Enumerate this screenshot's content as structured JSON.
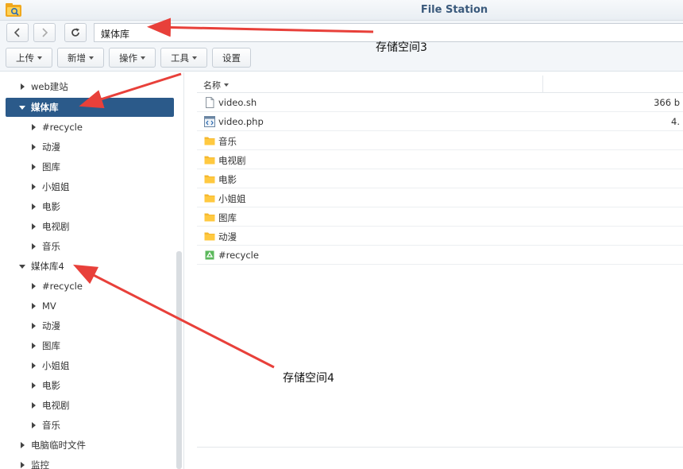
{
  "app": {
    "title": "File Station",
    "icon": "file-station-icon"
  },
  "nav": {
    "back_icon": "chevron-left-icon",
    "forward_icon": "chevron-right-icon",
    "refresh_icon": "refresh-icon",
    "path": "媒体库"
  },
  "toolbar": {
    "upload": "上传",
    "create": "新增",
    "action": "操作",
    "tools": "工具",
    "settings": "设置"
  },
  "tree": {
    "items": [
      {
        "label": "web建站"
      },
      {
        "label": "媒体库"
      },
      {
        "label": "#recycle"
      },
      {
        "label": "动漫"
      },
      {
        "label": "图库"
      },
      {
        "label": "小姐姐"
      },
      {
        "label": "电影"
      },
      {
        "label": "电视剧"
      },
      {
        "label": "音乐"
      },
      {
        "label": "媒体库4"
      },
      {
        "label": "#recycle"
      },
      {
        "label": "MV"
      },
      {
        "label": "动漫"
      },
      {
        "label": "图库"
      },
      {
        "label": "小姐姐"
      },
      {
        "label": "电影"
      },
      {
        "label": "电视剧"
      },
      {
        "label": "音乐"
      },
      {
        "label": "电脑临时文件"
      },
      {
        "label": "监控"
      }
    ]
  },
  "filelist": {
    "column_name": "名称",
    "rows": [
      {
        "name": "video.sh",
        "size": "366 b",
        "icon": "file-icon"
      },
      {
        "name": "video.php",
        "size": "4.",
        "icon": "code-file-icon"
      },
      {
        "name": "音乐",
        "size": "",
        "icon": "folder-icon"
      },
      {
        "name": "电视剧",
        "size": "",
        "icon": "folder-icon"
      },
      {
        "name": "电影",
        "size": "",
        "icon": "folder-icon"
      },
      {
        "name": "小姐姐",
        "size": "",
        "icon": "folder-icon"
      },
      {
        "name": "图库",
        "size": "",
        "icon": "folder-icon"
      },
      {
        "name": "动漫",
        "size": "",
        "icon": "folder-icon"
      },
      {
        "name": "#recycle",
        "size": "",
        "icon": "recycle-folder-icon"
      }
    ]
  },
  "annotations": {
    "label_3": "存储空间3",
    "label_4": "存储空间4",
    "arrow_color": "#e8403a"
  },
  "colors": {
    "selected_bg": "#2b5a8a",
    "folder": "#f5b82e",
    "recycle": "#5cb85c",
    "title_text": "#3b5a7c"
  }
}
